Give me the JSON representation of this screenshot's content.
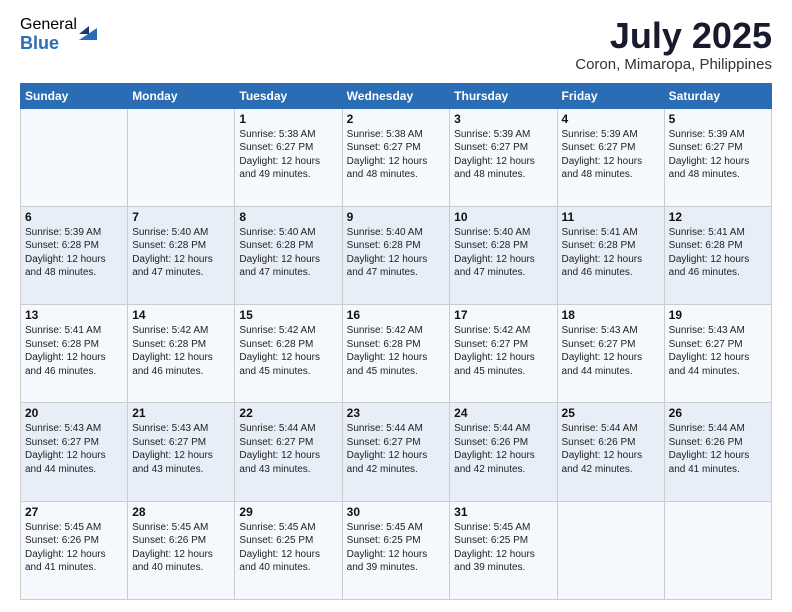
{
  "logo": {
    "general": "General",
    "blue": "Blue"
  },
  "title": "July 2025",
  "location": "Coron, Mimaropa, Philippines",
  "days_of_week": [
    "Sunday",
    "Monday",
    "Tuesday",
    "Wednesday",
    "Thursday",
    "Friday",
    "Saturday"
  ],
  "weeks": [
    [
      {
        "day": "",
        "sunrise": "",
        "sunset": "",
        "daylight": ""
      },
      {
        "day": "",
        "sunrise": "",
        "sunset": "",
        "daylight": ""
      },
      {
        "day": "1",
        "sunrise": "Sunrise: 5:38 AM",
        "sunset": "Sunset: 6:27 PM",
        "daylight": "Daylight: 12 hours and 49 minutes."
      },
      {
        "day": "2",
        "sunrise": "Sunrise: 5:38 AM",
        "sunset": "Sunset: 6:27 PM",
        "daylight": "Daylight: 12 hours and 48 minutes."
      },
      {
        "day": "3",
        "sunrise": "Sunrise: 5:39 AM",
        "sunset": "Sunset: 6:27 PM",
        "daylight": "Daylight: 12 hours and 48 minutes."
      },
      {
        "day": "4",
        "sunrise": "Sunrise: 5:39 AM",
        "sunset": "Sunset: 6:27 PM",
        "daylight": "Daylight: 12 hours and 48 minutes."
      },
      {
        "day": "5",
        "sunrise": "Sunrise: 5:39 AM",
        "sunset": "Sunset: 6:27 PM",
        "daylight": "Daylight: 12 hours and 48 minutes."
      }
    ],
    [
      {
        "day": "6",
        "sunrise": "Sunrise: 5:39 AM",
        "sunset": "Sunset: 6:28 PM",
        "daylight": "Daylight: 12 hours and 48 minutes."
      },
      {
        "day": "7",
        "sunrise": "Sunrise: 5:40 AM",
        "sunset": "Sunset: 6:28 PM",
        "daylight": "Daylight: 12 hours and 47 minutes."
      },
      {
        "day": "8",
        "sunrise": "Sunrise: 5:40 AM",
        "sunset": "Sunset: 6:28 PM",
        "daylight": "Daylight: 12 hours and 47 minutes."
      },
      {
        "day": "9",
        "sunrise": "Sunrise: 5:40 AM",
        "sunset": "Sunset: 6:28 PM",
        "daylight": "Daylight: 12 hours and 47 minutes."
      },
      {
        "day": "10",
        "sunrise": "Sunrise: 5:40 AM",
        "sunset": "Sunset: 6:28 PM",
        "daylight": "Daylight: 12 hours and 47 minutes."
      },
      {
        "day": "11",
        "sunrise": "Sunrise: 5:41 AM",
        "sunset": "Sunset: 6:28 PM",
        "daylight": "Daylight: 12 hours and 46 minutes."
      },
      {
        "day": "12",
        "sunrise": "Sunrise: 5:41 AM",
        "sunset": "Sunset: 6:28 PM",
        "daylight": "Daylight: 12 hours and 46 minutes."
      }
    ],
    [
      {
        "day": "13",
        "sunrise": "Sunrise: 5:41 AM",
        "sunset": "Sunset: 6:28 PM",
        "daylight": "Daylight: 12 hours and 46 minutes."
      },
      {
        "day": "14",
        "sunrise": "Sunrise: 5:42 AM",
        "sunset": "Sunset: 6:28 PM",
        "daylight": "Daylight: 12 hours and 46 minutes."
      },
      {
        "day": "15",
        "sunrise": "Sunrise: 5:42 AM",
        "sunset": "Sunset: 6:28 PM",
        "daylight": "Daylight: 12 hours and 45 minutes."
      },
      {
        "day": "16",
        "sunrise": "Sunrise: 5:42 AM",
        "sunset": "Sunset: 6:28 PM",
        "daylight": "Daylight: 12 hours and 45 minutes."
      },
      {
        "day": "17",
        "sunrise": "Sunrise: 5:42 AM",
        "sunset": "Sunset: 6:27 PM",
        "daylight": "Daylight: 12 hours and 45 minutes."
      },
      {
        "day": "18",
        "sunrise": "Sunrise: 5:43 AM",
        "sunset": "Sunset: 6:27 PM",
        "daylight": "Daylight: 12 hours and 44 minutes."
      },
      {
        "day": "19",
        "sunrise": "Sunrise: 5:43 AM",
        "sunset": "Sunset: 6:27 PM",
        "daylight": "Daylight: 12 hours and 44 minutes."
      }
    ],
    [
      {
        "day": "20",
        "sunrise": "Sunrise: 5:43 AM",
        "sunset": "Sunset: 6:27 PM",
        "daylight": "Daylight: 12 hours and 44 minutes."
      },
      {
        "day": "21",
        "sunrise": "Sunrise: 5:43 AM",
        "sunset": "Sunset: 6:27 PM",
        "daylight": "Daylight: 12 hours and 43 minutes."
      },
      {
        "day": "22",
        "sunrise": "Sunrise: 5:44 AM",
        "sunset": "Sunset: 6:27 PM",
        "daylight": "Daylight: 12 hours and 43 minutes."
      },
      {
        "day": "23",
        "sunrise": "Sunrise: 5:44 AM",
        "sunset": "Sunset: 6:27 PM",
        "daylight": "Daylight: 12 hours and 42 minutes."
      },
      {
        "day": "24",
        "sunrise": "Sunrise: 5:44 AM",
        "sunset": "Sunset: 6:26 PM",
        "daylight": "Daylight: 12 hours and 42 minutes."
      },
      {
        "day": "25",
        "sunrise": "Sunrise: 5:44 AM",
        "sunset": "Sunset: 6:26 PM",
        "daylight": "Daylight: 12 hours and 42 minutes."
      },
      {
        "day": "26",
        "sunrise": "Sunrise: 5:44 AM",
        "sunset": "Sunset: 6:26 PM",
        "daylight": "Daylight: 12 hours and 41 minutes."
      }
    ],
    [
      {
        "day": "27",
        "sunrise": "Sunrise: 5:45 AM",
        "sunset": "Sunset: 6:26 PM",
        "daylight": "Daylight: 12 hours and 41 minutes."
      },
      {
        "day": "28",
        "sunrise": "Sunrise: 5:45 AM",
        "sunset": "Sunset: 6:26 PM",
        "daylight": "Daylight: 12 hours and 40 minutes."
      },
      {
        "day": "29",
        "sunrise": "Sunrise: 5:45 AM",
        "sunset": "Sunset: 6:25 PM",
        "daylight": "Daylight: 12 hours and 40 minutes."
      },
      {
        "day": "30",
        "sunrise": "Sunrise: 5:45 AM",
        "sunset": "Sunset: 6:25 PM",
        "daylight": "Daylight: 12 hours and 39 minutes."
      },
      {
        "day": "31",
        "sunrise": "Sunrise: 5:45 AM",
        "sunset": "Sunset: 6:25 PM",
        "daylight": "Daylight: 12 hours and 39 minutes."
      },
      {
        "day": "",
        "sunrise": "",
        "sunset": "",
        "daylight": ""
      },
      {
        "day": "",
        "sunrise": "",
        "sunset": "",
        "daylight": ""
      }
    ]
  ]
}
